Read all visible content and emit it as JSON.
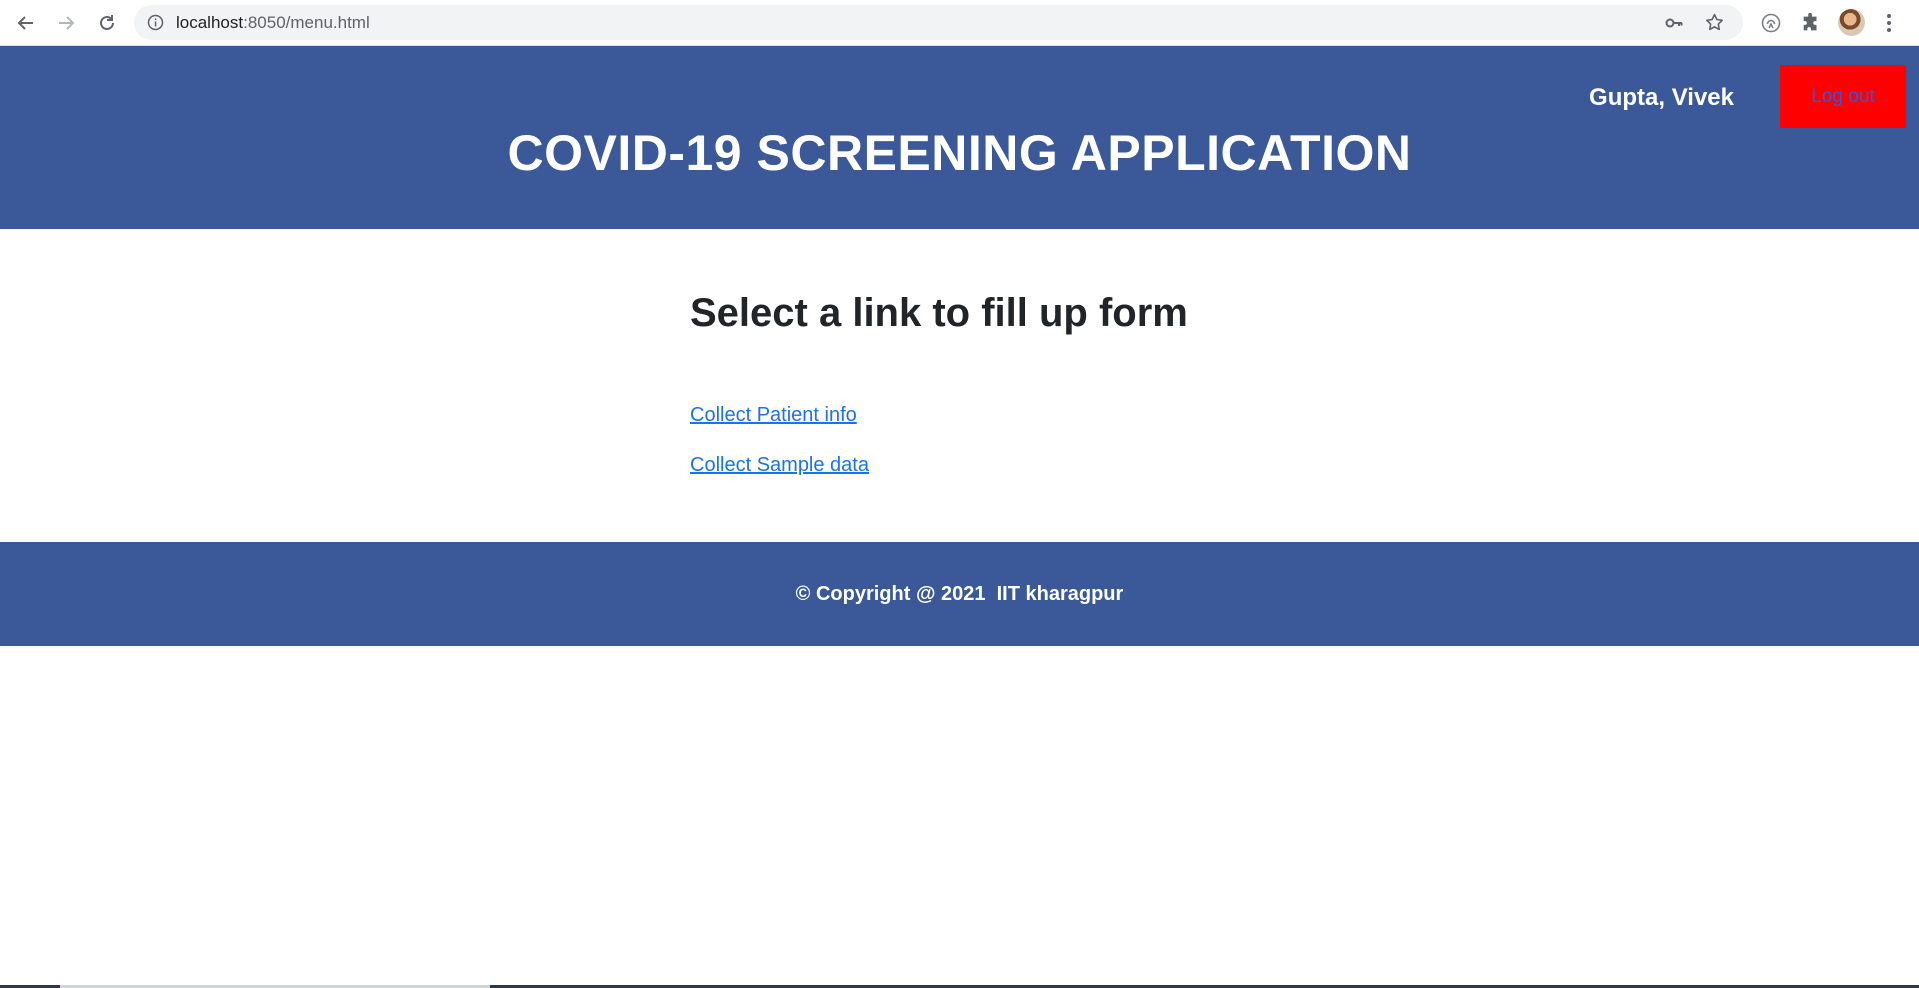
{
  "browser": {
    "url_host": "localhost",
    "url_rest": ":8050/menu.html",
    "icons": {
      "back": "arrow-left-icon",
      "forward": "arrow-right-icon",
      "reload": "reload-icon",
      "info": "info-icon",
      "key": "key-icon",
      "star": "star-icon",
      "media": "media-router-icon",
      "extensions": "puzzle-icon",
      "profile": "avatar",
      "menu": "kebab-menu-icon"
    }
  },
  "header": {
    "user_name": "Gupta, Vivek",
    "logout_label": "Log out",
    "title": "COVID-19 SCREENING APPLICATION"
  },
  "main": {
    "heading": "Select a link to fill up form",
    "links": [
      {
        "label": "Collect Patient info"
      },
      {
        "label": "Collect Sample data"
      }
    ]
  },
  "footer": {
    "text": "© Copyright @ 2021  IIT kharagpur"
  },
  "colors": {
    "header_bg": "#3b5998",
    "logout_bg": "#ff0000",
    "logout_text": "#3b55d9",
    "link": "#1a73e8"
  }
}
